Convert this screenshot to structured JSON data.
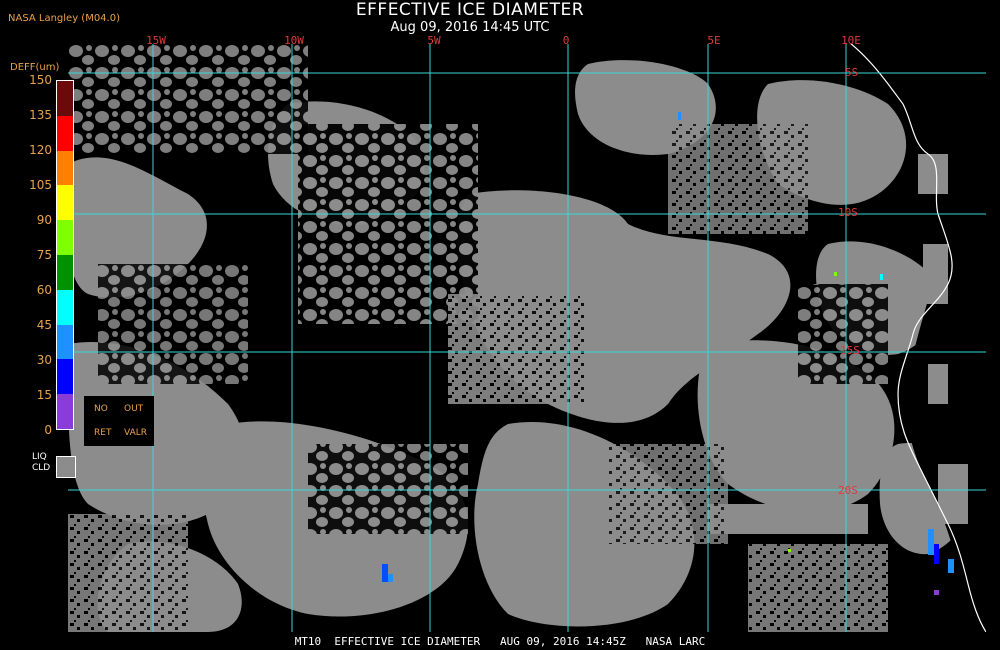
{
  "header": {
    "title": "EFFECTIVE ICE DIAMETER",
    "subtitle": "Aug 09, 2016 14:45 UTC",
    "provider": "NASA Langley (M04.0)"
  },
  "colorbar": {
    "title": "DEFF(um)",
    "ticks": [
      "150",
      "135",
      "120",
      "105",
      "90",
      "75",
      "60",
      "45",
      "30",
      "15",
      "0"
    ],
    "colors": [
      "#6a0a0a",
      "#ff0000",
      "#ff7f00",
      "#ffff00",
      "#80ff00",
      "#009000",
      "#00ffff",
      "#1e90ff",
      "#0000ff",
      "#8a3cd8"
    ]
  },
  "legend": {
    "no": "NO",
    "out": "OUT",
    "ret": "RET",
    "valr": "VALR",
    "liq_line1": "LIQ",
    "liq_line2": "CLD",
    "liq_color": "#8c8c8c"
  },
  "map": {
    "lon_labels": [
      "15W",
      "10W",
      "5W",
      "0",
      "5E",
      "10E"
    ],
    "lat_labels": [
      "5S",
      "10S",
      "15S",
      "20S"
    ],
    "grid_color": "#3ad6d6",
    "coast_color": "#ffffff"
  },
  "footer": {
    "text": "MT10  EFFECTIVE ICE DIAMETER   AUG 09, 2016 14:45Z   NASA LARC"
  }
}
